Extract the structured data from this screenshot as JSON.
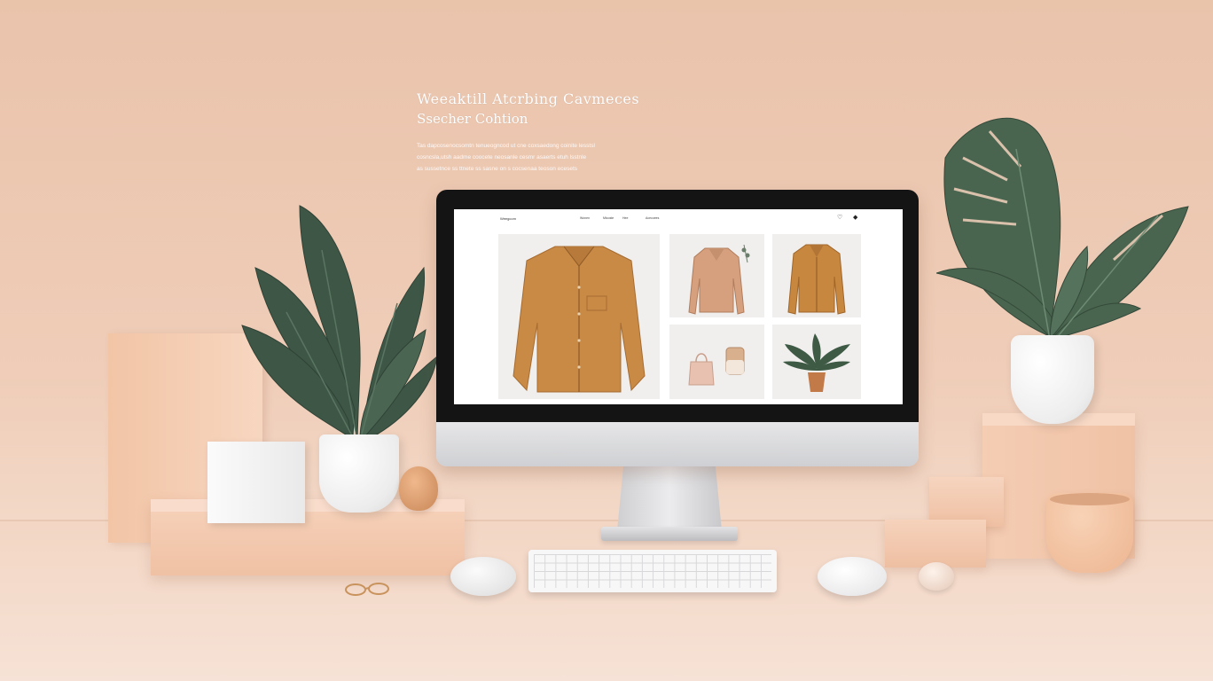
{
  "headline": {
    "line1": "Weeaktill Atcrbing Cavmeces",
    "line2": "Ssecher Cohtion",
    "blurb": [
      "Tas dapcosenocsomtn tenueogncod ut cne coxsaedong coinite lesstsl",
      "cosncsla,utsh aadme coocete neosanle cesmr asaerts etuh lsstnle",
      "as sussetnce ss ttnete ss sasne on s cocsenaa teoson ecesets"
    ]
  },
  "screen": {
    "brand": "Weegcom",
    "nav_links": [
      "Wonen",
      "Mtcoste",
      "Hee",
      "Acecoees"
    ],
    "icons": [
      "heart-icon",
      "bag-icon"
    ],
    "products": [
      {
        "name": "jacket-large"
      },
      {
        "name": "shirt-jacket"
      },
      {
        "name": "jacket-mustard"
      },
      {
        "name": "bags"
      },
      {
        "name": "potted-plant"
      }
    ]
  },
  "colors": {
    "background": "#eac3ab",
    "accent_jacket": "#c98a45",
    "leaf": "#3f5a46",
    "pedestal": "#f2c5a6"
  }
}
